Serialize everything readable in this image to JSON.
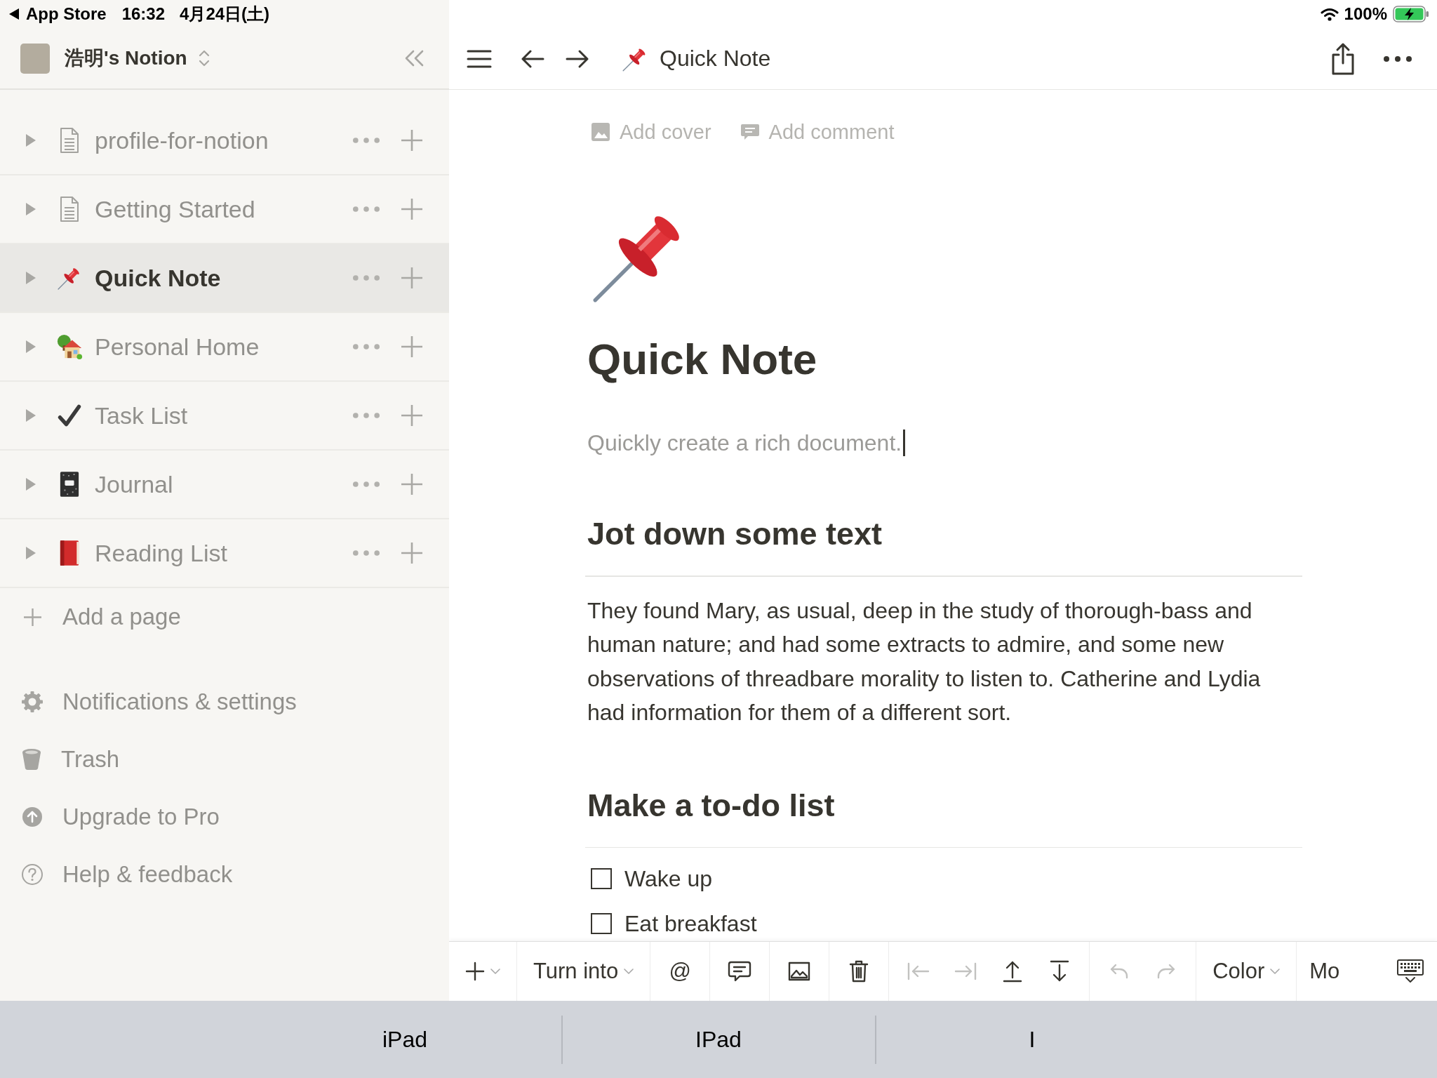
{
  "status_bar": {
    "back_label": "App Store",
    "time": "16:32",
    "date": "4月24日(土)",
    "battery": "100%"
  },
  "sidebar": {
    "workspace": "浩明's Notion",
    "pages": [
      {
        "kind": "page",
        "label": "profile-for-notion",
        "selected": false
      },
      {
        "kind": "page",
        "label": "Getting Started",
        "selected": false
      },
      {
        "kind": "pin",
        "label": "Quick Note",
        "selected": true
      },
      {
        "kind": "home",
        "label": "Personal Home",
        "selected": false
      },
      {
        "kind": "check",
        "label": "Task List",
        "selected": false
      },
      {
        "kind": "notebook",
        "label": "Journal",
        "selected": false
      },
      {
        "kind": "book",
        "label": "Reading List",
        "selected": false
      }
    ],
    "add_page": "Add a page",
    "links": [
      {
        "kind": "settings",
        "label": "Notifications & settings"
      },
      {
        "kind": "trash",
        "label": "Trash"
      },
      {
        "kind": "upgrade",
        "label": "Upgrade to Pro"
      },
      {
        "kind": "help",
        "label": "Help & feedback"
      }
    ]
  },
  "topbar": {
    "title": "Quick Note"
  },
  "page": {
    "actions": [
      {
        "kind": "cover",
        "label": "Add cover"
      },
      {
        "kind": "comment",
        "label": "Add comment"
      }
    ],
    "title": "Quick Note",
    "description": "Quickly create a rich document.",
    "blocks": [
      {
        "kind": "heading",
        "text": "Jot down some text"
      },
      {
        "kind": "paragraph",
        "text": "They found Mary, as usual, deep in the study of thorough-bass and human nature; and had some extracts to admire, and some new observations of threadbare morality to listen to. Catherine and Lydia had information for them of a different sort."
      },
      {
        "kind": "heading",
        "text": "Make a to-do list"
      },
      {
        "kind": "todo",
        "text": "Wake up",
        "checked": false
      },
      {
        "kind": "todo",
        "text": "Eat breakfast",
        "checked": false
      }
    ]
  },
  "format_toolbar": {
    "groups": [
      {
        "items": [
          {
            "kind": "insert",
            "dropdown": true,
            "disabled": false
          }
        ]
      },
      {
        "items": [
          {
            "kind": "turn_into",
            "label": "Turn into",
            "dropdown": true,
            "disabled": false
          }
        ]
      },
      {
        "items": [
          {
            "kind": "mention",
            "label": "@",
            "dropdown": false,
            "disabled": false
          }
        ]
      },
      {
        "items": [
          {
            "kind": "comment",
            "dropdown": false,
            "disabled": false
          }
        ]
      },
      {
        "items": [
          {
            "kind": "image",
            "dropdown": false,
            "disabled": false
          }
        ]
      },
      {
        "items": [
          {
            "kind": "delete",
            "dropdown": false,
            "disabled": false
          }
        ]
      },
      {
        "items": [
          {
            "kind": "outdent",
            "dropdown": false,
            "disabled": true
          },
          {
            "kind": "indent",
            "dropdown": false,
            "disabled": true
          },
          {
            "kind": "move_up",
            "dropdown": false,
            "disabled": false
          },
          {
            "kind": "move_down",
            "dropdown": false,
            "disabled": false
          }
        ]
      },
      {
        "items": [
          {
            "kind": "undo",
            "dropdown": false,
            "disabled": true
          },
          {
            "kind": "redo",
            "dropdown": false,
            "disabled": true
          }
        ]
      },
      {
        "items": [
          {
            "kind": "color",
            "label": "Color",
            "dropdown": true,
            "disabled": false
          }
        ]
      },
      {
        "items": [
          {
            "kind": "label",
            "label": "Mo",
            "dropdown": false,
            "disabled": false
          }
        ]
      }
    ]
  },
  "keyboard_suggestions": [
    "iPad",
    "IPad",
    "I"
  ]
}
